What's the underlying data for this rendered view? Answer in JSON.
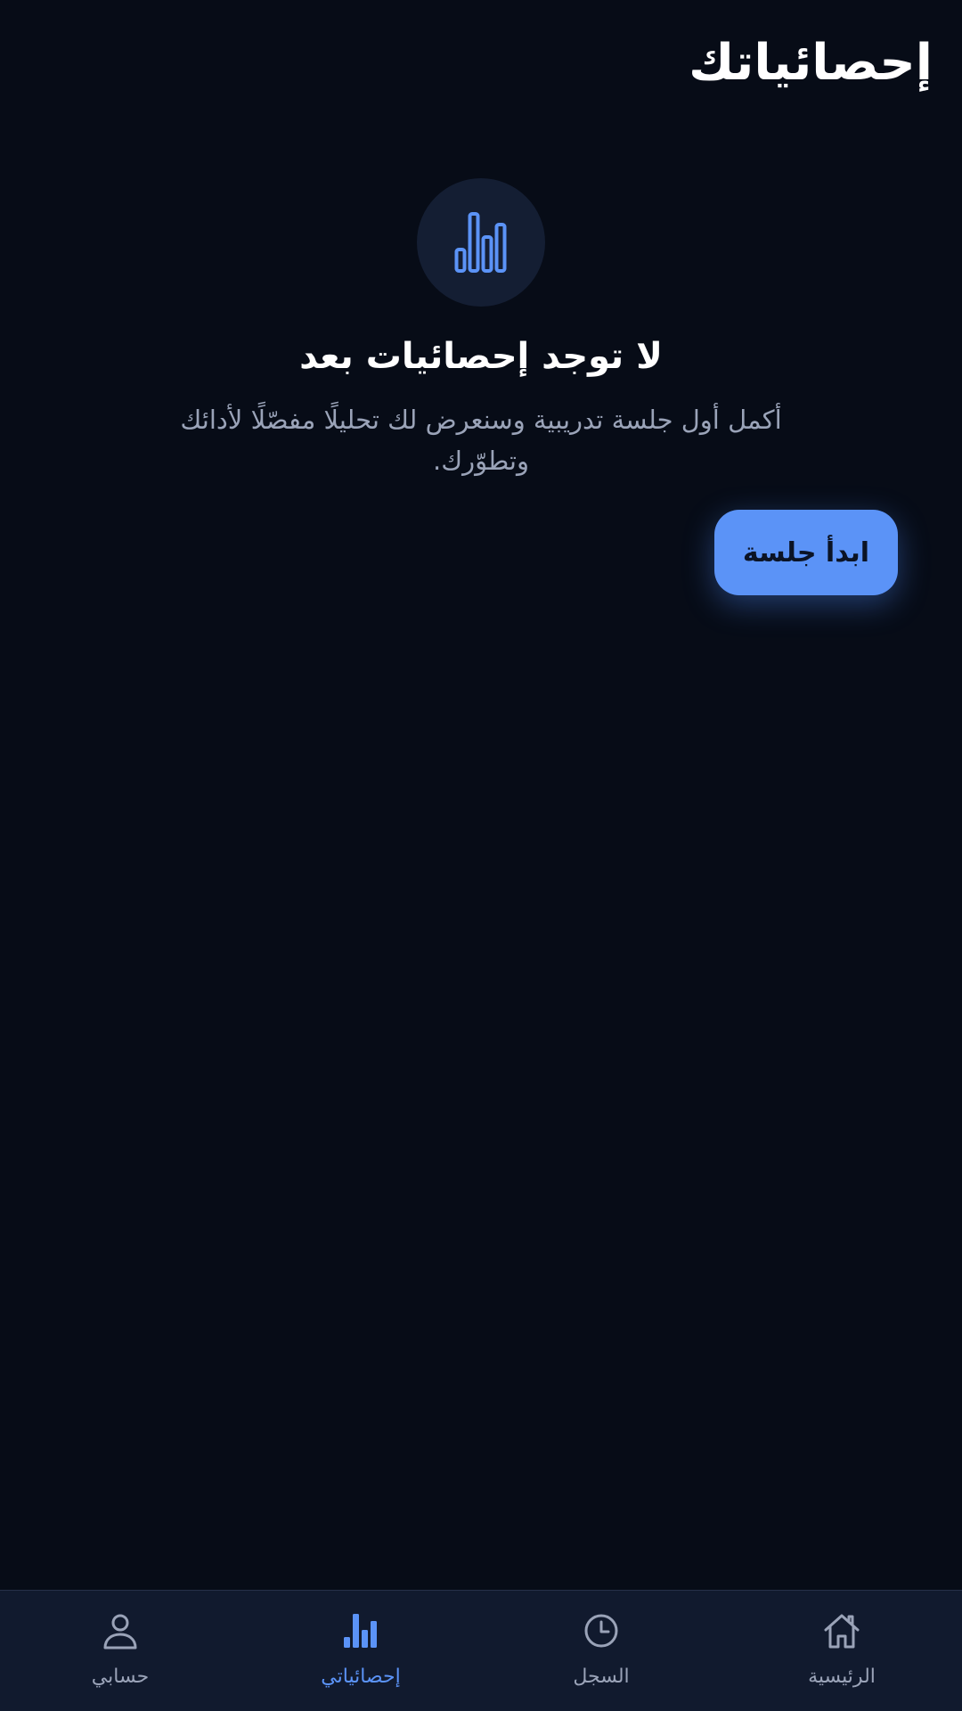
{
  "header": {
    "title": "إحصائياتك"
  },
  "empty_state": {
    "icon": "bar-chart-icon",
    "title": "لا توجد إحصائيات بعد",
    "description": "أكمل أول جلسة تدريبية وسنعرض لك تحليلًا مفصّلًا لأدائك وتطوّرك.",
    "action_label": "ابدأ جلسة"
  },
  "bottom_nav": {
    "items": [
      {
        "label": "الرئيسية",
        "icon": "home-icon",
        "active": false
      },
      {
        "label": "السجل",
        "icon": "clock-icon",
        "active": false
      },
      {
        "label": "إحصائياتي",
        "icon": "bar-chart-icon",
        "active": true
      },
      {
        "label": "حسابي",
        "icon": "user-icon",
        "active": false
      }
    ]
  },
  "colors": {
    "background": "#070c17",
    "accent": "#5b93f7",
    "nav_background": "#111a2e",
    "muted_text": "#9aa3b8"
  }
}
